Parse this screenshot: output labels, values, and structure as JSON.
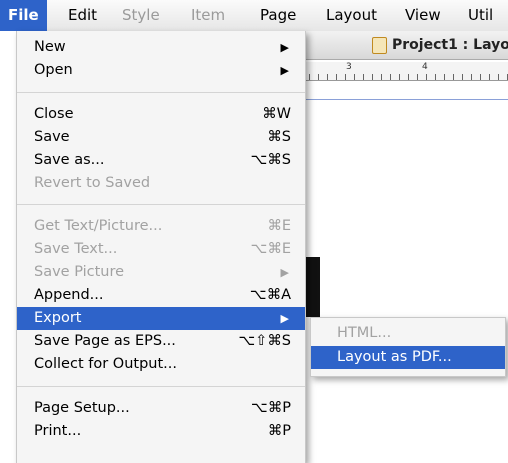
{
  "menubar": {
    "items": [
      "File",
      "Edit",
      "Style",
      "Item",
      "Page",
      "Layout",
      "View",
      "Util"
    ]
  },
  "window": {
    "title": "Project1 : Layo",
    "ruler_marks": [
      "3",
      "4"
    ]
  },
  "file_menu": {
    "new": "New",
    "open": "Open",
    "close": "Close",
    "close_sc": "⌘W",
    "save": "Save",
    "save_sc": "⌘S",
    "save_as": "Save as...",
    "save_as_sc": "⌥⌘S",
    "revert": "Revert to Saved",
    "get_text": "Get Text/Picture...",
    "get_text_sc": "⌘E",
    "save_text": "Save Text...",
    "save_text_sc": "⌥⌘E",
    "save_picture": "Save Picture",
    "append": "Append...",
    "append_sc": "⌥⌘A",
    "export": "Export",
    "save_eps": "Save Page as EPS...",
    "save_eps_sc": "⌥⇧⌘S",
    "collect": "Collect for Output...",
    "page_setup": "Page Setup...",
    "page_setup_sc": "⌥⌘P",
    "print": "Print...",
    "print_sc": "⌘P"
  },
  "export_submenu": {
    "html": "HTML...",
    "layout_pdf": "Layout as PDF..."
  },
  "colors": {
    "highlight": "#2e63c9"
  },
  "icons": {
    "submenu_arrow": "▶"
  }
}
